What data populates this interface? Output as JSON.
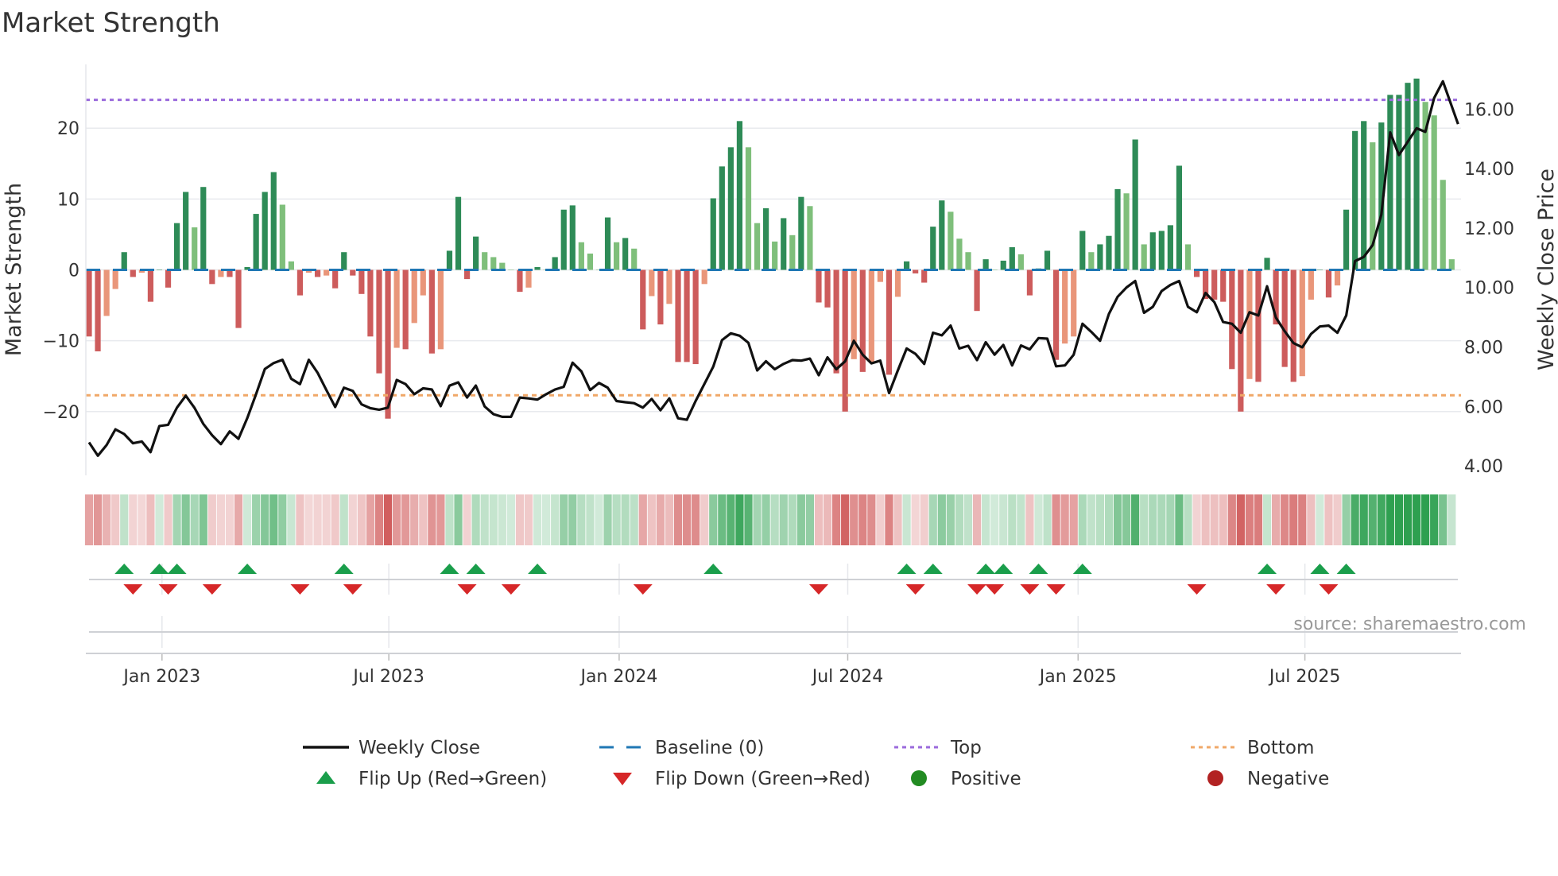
{
  "chart_data": {
    "type": "bar",
    "title": "Market Strength",
    "ylabel": "Market Strength",
    "y2label": "Weekly Close Price",
    "ylim": [
      -29,
      29
    ],
    "y2lim": [
      3.68,
      17.51
    ],
    "yticks": [
      "20",
      "10",
      "0",
      "−10",
      "−20"
    ],
    "ytick_values": [
      20,
      10,
      0,
      -10,
      -20
    ],
    "y2ticks": [
      "16.00",
      "14.00",
      "12.00",
      "10.00",
      "8.00",
      "6.00",
      "4.00"
    ],
    "y2tick_values": [
      16,
      14,
      12,
      10,
      8,
      6,
      4
    ],
    "x_unit": "week index",
    "x_ticks": [
      {
        "label": "Jan 2023",
        "week_index": 8.3
      },
      {
        "label": "Jul 2023",
        "week_index": 34.1
      },
      {
        "label": "Jan 2024",
        "week_index": 60.3
      },
      {
        "label": "Jul 2024",
        "week_index": 86.3
      },
      {
        "label": "Jan 2025",
        "week_index": 112.5
      },
      {
        "label": "Jul 2025",
        "week_index": 138.3
      }
    ],
    "top_level": 24,
    "bottom_level": -17.7,
    "baseline": 0,
    "strength": [
      -9.4,
      -11.5,
      -6.5,
      -2.7,
      2.5,
      -1,
      -0.4,
      -4.5,
      0,
      -2.5,
      6.6,
      11,
      6,
      11.7,
      -2,
      -1,
      -1,
      -8.2,
      0.4,
      7.9,
      11,
      13.8,
      9.2,
      1.2,
      -3.6,
      -0.4,
      -1,
      -0.8,
      -2.6,
      2.5,
      -0.8,
      -3.4,
      -9.4,
      -14.6,
      -21,
      -11,
      -11.2,
      -7.5,
      -3.6,
      -11.8,
      -11.2,
      2.7,
      10.3,
      -1.3,
      4.7,
      2.5,
      1.8,
      1,
      0,
      -3.1,
      -2.5,
      0.4,
      0,
      1.8,
      8.5,
      9.1,
      3.9,
      2.3,
      0,
      7.4,
      3.9,
      4.5,
      3,
      -8.4,
      -3.7,
      -7.7,
      -4.8,
      -13,
      -13,
      -13.3,
      -2,
      10.1,
      14.6,
      17.3,
      21,
      17.3,
      6.6,
      8.7,
      4,
      7.3,
      4.9,
      10.3,
      9,
      -4.6,
      -5.3,
      -14.6,
      -20,
      -12.6,
      -14.4,
      -13,
      -1.7,
      -14.8,
      -3.8,
      1.2,
      -0.5,
      -1.8,
      6.1,
      9.8,
      8.2,
      4.4,
      2.5,
      -5.8,
      1.5,
      0,
      1.3,
      3.2,
      2.2,
      -3.6,
      0.2,
      2.7,
      -12.7,
      -10.4,
      -9.4,
      5.5,
      2.5,
      3.6,
      4.8,
      11.4,
      10.8,
      18.4,
      3.6,
      5.3,
      5.5,
      6.3,
      14.7,
      3.6,
      -1,
      -4.1,
      -4.2,
      -4.5,
      -14,
      -20,
      -15.4,
      -15.8,
      1.7,
      -7.7,
      -13.7,
      -15.8,
      -15,
      -4.2,
      0,
      -3.9,
      -2.2,
      8.5,
      19.6,
      21,
      18,
      20.8,
      24.7,
      24.7,
      26.4,
      27,
      23.7,
      21.8,
      12.7,
      1.5
    ],
    "weekly_close": [
      4.79,
      4.34,
      4.7,
      5.23,
      5.07,
      4.76,
      4.82,
      4.46,
      5.34,
      5.38,
      5.96,
      6.36,
      5.95,
      5.41,
      5.03,
      4.73,
      5.16,
      4.91,
      5.61,
      6.41,
      7.26,
      7.46,
      7.57,
      6.93,
      6.75,
      7.57,
      7.13,
      6.55,
      5.98,
      6.63,
      6.52,
      6.07,
      5.94,
      5.89,
      5.96,
      6.89,
      6.75,
      6.41,
      6.61,
      6.57,
      6.01,
      6.7,
      6.81,
      6.3,
      6.7,
      6.0,
      5.74,
      5.65,
      5.65,
      6.3,
      6.27,
      6.23,
      6.41,
      6.57,
      6.66,
      7.47,
      7.18,
      6.55,
      6.79,
      6.63,
      6.18,
      6.14,
      6.11,
      5.96,
      6.25,
      5.87,
      6.27,
      5.6,
      5.55,
      6.18,
      6.76,
      7.34,
      8.23,
      8.46,
      8.38,
      8.14,
      7.21,
      7.52,
      7.25,
      7.43,
      7.56,
      7.54,
      7.61,
      7.05,
      7.65,
      7.25,
      7.52,
      8.21,
      7.74,
      7.45,
      7.54,
      6.45,
      7.21,
      7.95,
      7.77,
      7.43,
      8.48,
      8.39,
      8.72,
      7.95,
      8.04,
      7.56,
      8.16,
      7.74,
      8.07,
      7.38,
      8.05,
      7.92,
      8.3,
      8.28,
      7.35,
      7.38,
      7.74,
      8.78,
      8.51,
      8.21,
      9.11,
      9.69,
      10.0,
      10.22,
      9.15,
      9.35,
      9.88,
      10.09,
      10.22,
      9.35,
      9.17,
      9.82,
      9.51,
      8.84,
      8.78,
      8.48,
      9.17,
      9.06,
      10.04,
      8.99,
      8.53,
      8.13,
      7.99,
      8.44,
      8.69,
      8.72,
      8.48,
      9.06,
      10.89,
      11.03,
      11.43,
      12.46,
      15.22,
      14.46,
      14.91,
      15.36,
      15.24,
      16.38,
      16.94,
      15.5
    ],
    "flip_up_weeks": [
      4,
      8,
      10,
      18,
      29,
      41,
      44,
      51,
      71,
      93,
      96,
      102,
      104,
      108,
      113,
      134,
      140,
      143
    ],
    "flip_down_weeks": [
      5,
      9,
      14,
      24,
      30,
      43,
      48,
      63,
      83,
      94,
      101,
      103,
      107,
      110,
      126,
      135,
      141
    ],
    "legend": {
      "position": "bottom",
      "items": [
        {
          "label": "Weekly Close",
          "kind": "line",
          "color": "#111111"
        },
        {
          "label": "Baseline (0)",
          "kind": "dash",
          "color": "#1f77b4"
        },
        {
          "label": "Top",
          "kind": "dot",
          "color": "#9b6bdc"
        },
        {
          "label": "Bottom",
          "kind": "dot",
          "color": "#f0a868"
        },
        {
          "label": "Flip Up (Red→Green)",
          "kind": "tri-up",
          "color": "#1a9e4b"
        },
        {
          "label": "Flip Down (Green→Red)",
          "kind": "tri-down",
          "color": "#d62728"
        },
        {
          "label": "Positive",
          "kind": "circle",
          "color": "#228b22"
        },
        {
          "label": "Negative",
          "kind": "circle",
          "color": "#b22222"
        }
      ]
    },
    "colors": {
      "pos_rising": "#2e8b57",
      "pos_falling": "#7fbf7b",
      "neg_falling": "#cd5c5c",
      "neg_rising": "#e9967a",
      "grid": "#e8eaee"
    },
    "source": "source: sharemaestro.com"
  }
}
